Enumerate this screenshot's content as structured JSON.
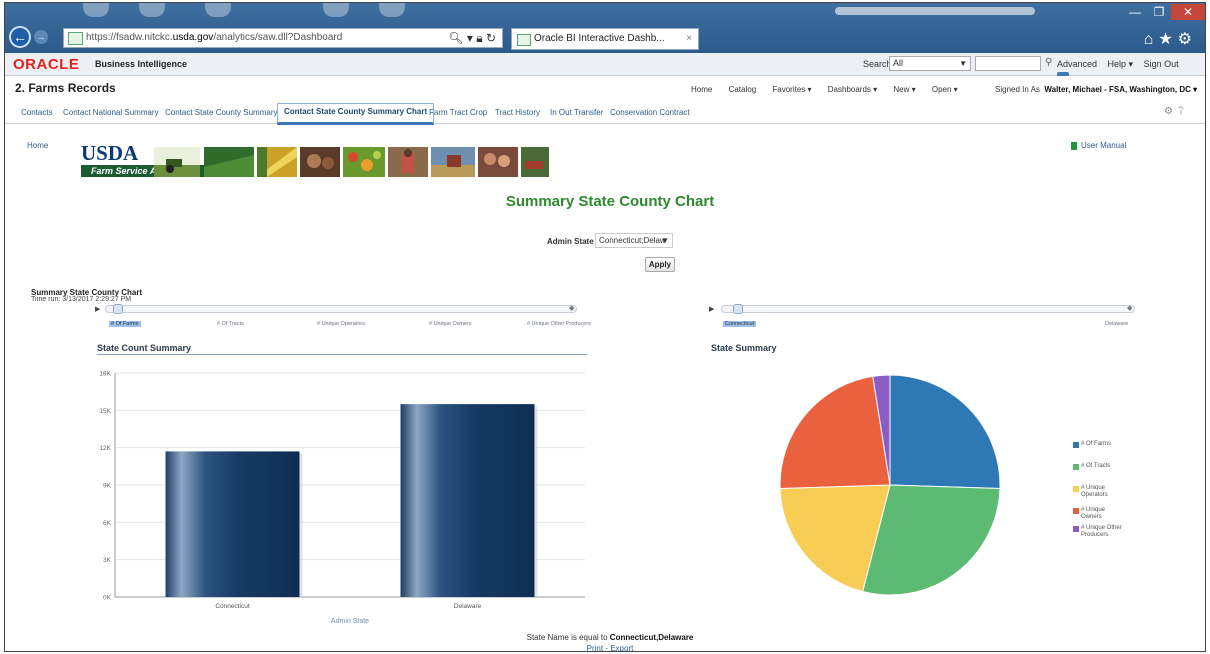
{
  "browser": {
    "url_prefix": "https://fsadw.nitckc.",
    "url_domain": "usda.gov",
    "url_suffix": "/analytics/saw.dll?Dashboard",
    "tab_title": "Oracle BI Interactive Dashb...",
    "tab_close": "×"
  },
  "header": {
    "logo": "ORACLE",
    "product": "Business Intelligence",
    "search_label": "Search",
    "search_scope": "All",
    "advanced": "Advanced",
    "help": "Help ▾",
    "sign_out": "Sign Out"
  },
  "title_row": {
    "dashboard_title": "2. Farms Records",
    "menu": [
      "Home",
      "Catalog",
      "Favorites ▾",
      "Dashboards ▾",
      "New ▾",
      "Open ▾"
    ],
    "signed_in_label": "Signed In As",
    "signed_in_user": "Walter, Michael - FSA, Washington, DC ▾"
  },
  "tabs": [
    "Contacts",
    "Contact National Summary",
    "Contact State County Summary",
    "Contact State County Summary Chart",
    "Farm Tract Crop",
    "Tract History",
    "In Out Transfer",
    "Conservation Contract"
  ],
  "content": {
    "home_link": "Home",
    "usda": "USDA",
    "fsa": "Farm Service Agency",
    "user_manual": "User Manual",
    "page_title": "Summary State County Chart",
    "prompt_label": "Admin State",
    "prompt_value": "Connecticut;Delaw",
    "apply": "Apply",
    "report_title": "Summary State County Chart",
    "time_run": "Time run: 3/13/2017 2:29:27 PM",
    "slider_left_labels": [
      "# Of Farms",
      "# Of Tracts",
      "# Unique Operators",
      "# Unique Owners",
      "# Unique Other Producers"
    ],
    "slider_right_labels": [
      "Connecticut",
      "Delaware"
    ],
    "filter_prefix": "State Name is equal to",
    "filter_value": "Connecticut,Delaware",
    "print_export": "Print - Export"
  },
  "colors": {
    "accent": "#3c79b8",
    "title_green": "#2d8a2d",
    "oracle_red": "#e0251b"
  },
  "chart_data": [
    {
      "type": "bar",
      "title": "State Count Summary",
      "categories": [
        "Connecticut",
        "Delaware"
      ],
      "values": [
        11700,
        15500
      ],
      "xlabel": "Admin State",
      "ylabel": "",
      "ylim": [
        0,
        18000
      ],
      "yticks": [
        "0K",
        "3K",
        "6K",
        "9K",
        "12K",
        "15K",
        "18K"
      ],
      "grid": true
    },
    {
      "type": "pie",
      "title": "State Summary",
      "labels": [
        "# Of Farms",
        "# Of Tracts",
        "# Unique Operators",
        "# Unique Owners",
        "# Unique Other Producers"
      ],
      "values": [
        25.5,
        28.5,
        20.5,
        23,
        2.5
      ],
      "colors": [
        "#2d78b5",
        "#5cba72",
        "#f7cd55",
        "#e9613f",
        "#8a5cc4"
      ],
      "legend": "right"
    }
  ]
}
